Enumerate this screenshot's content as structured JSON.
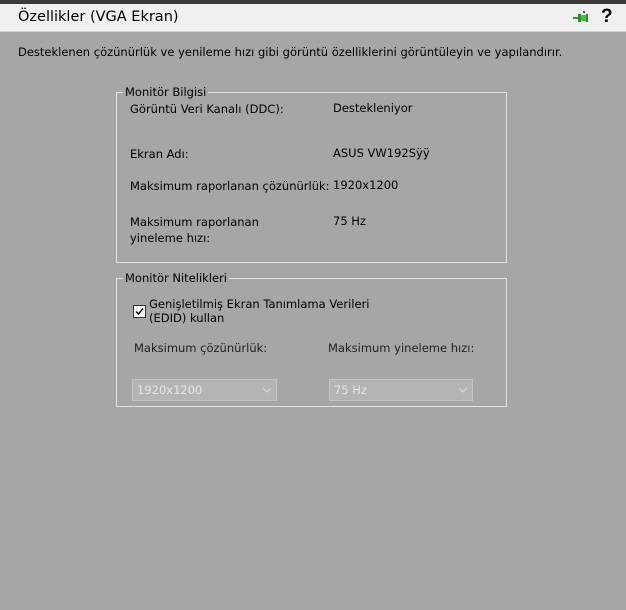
{
  "window": {
    "title": "Özellikler (VGA Ekran)",
    "help": "?"
  },
  "description": "Desteklenen çözünürlük ve yenileme hızı gibi görüntü özelliklerini görüntüleyin ve yapılandırır.",
  "monitor_info": {
    "legend": "Monitör Bilgisi",
    "rows": [
      {
        "label": "Görüntü Veri Kanalı (DDC):",
        "value": "Destekleniyor"
      },
      {
        "label": "Ekran Adı:",
        "value": "ASUS VW192Sÿÿ"
      },
      {
        "label": "Maksimum raporlanan çözünürlük:",
        "value": "1920x1200"
      },
      {
        "label": "Maksimum raporlanan yineleme hızı:",
        "value": "75 Hz"
      }
    ]
  },
  "monitor_props": {
    "legend": "Monitör Nitelikleri",
    "edid_label": "Genişletilmiş Ekran Tanımlama Verileri (EDID) kullan",
    "edid_checked": true,
    "max_resolution_label": "Maksimum çözünürlük:",
    "max_resolution_value": "1920x1200",
    "max_refresh_label": "Maksimum yineleme hızı:",
    "max_refresh_value": "75 Hz"
  }
}
